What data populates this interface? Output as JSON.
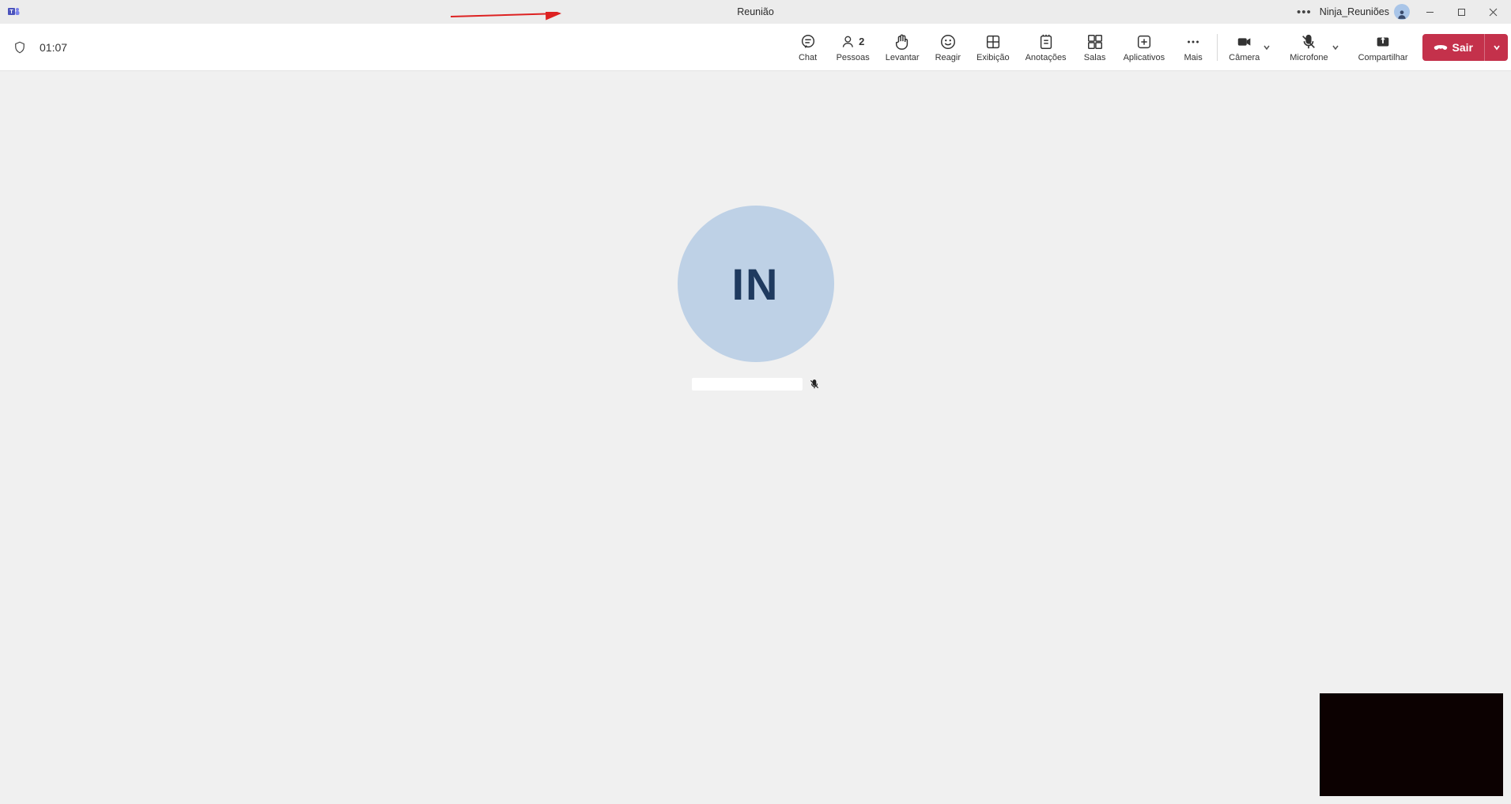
{
  "window": {
    "title": "Reunião",
    "user_name": "Ninja_Reuniões"
  },
  "toolbar": {
    "timer": "01:07",
    "chat": "Chat",
    "people": "Pessoas",
    "people_count": "2",
    "raise": "Levantar",
    "react": "Reagir",
    "view": "Exibição",
    "notes": "Anotações",
    "rooms": "Salas",
    "apps": "Aplicativos",
    "more": "Mais",
    "camera": "Câmera",
    "mic": "Microfone",
    "share": "Compartilhar",
    "leave": "Sair"
  },
  "stage": {
    "initials": "IN"
  },
  "colors": {
    "leave": "#c4314b",
    "avatar_bg": "#bed1e6",
    "avatar_fg": "#1f3a5f"
  }
}
